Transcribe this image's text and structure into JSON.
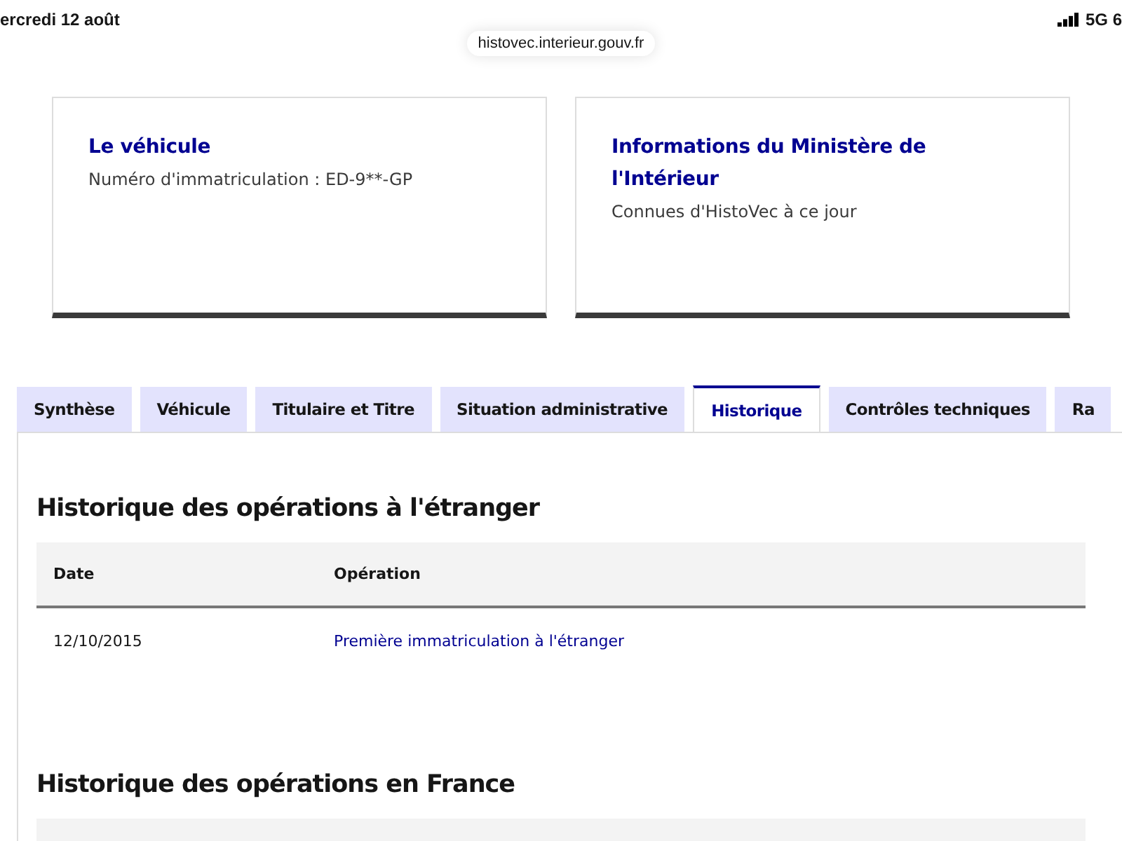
{
  "status_bar": {
    "date": "ercredi 12 août",
    "network": "5G 6"
  },
  "address_bar": {
    "url": "histovec.interieur.gouv.fr"
  },
  "cards": [
    {
      "title": "Le véhicule",
      "text": "Numéro d'immatriculation : ED-9**-GP"
    },
    {
      "title": "Informations du Ministère de l'Intérieur",
      "text": "Connues d'HistoVec à ce jour"
    }
  ],
  "tabs": [
    {
      "label": "Synthèse",
      "selected": false
    },
    {
      "label": "Véhicule",
      "selected": false
    },
    {
      "label": "Titulaire et Titre",
      "selected": false
    },
    {
      "label": "Situation administrative",
      "selected": false
    },
    {
      "label": "Historique",
      "selected": true
    },
    {
      "label": "Contrôles techniques",
      "selected": false
    },
    {
      "label": "Ra",
      "selected": false
    }
  ],
  "sections": [
    {
      "title": "Historique des opérations à l'étranger",
      "table": {
        "columns": [
          "Date",
          "Opération"
        ],
        "rows": [
          [
            "12/10/2015",
            "Première immatriculation à l'étranger"
          ]
        ]
      }
    },
    {
      "title": "Historique des opérations en France"
    }
  ]
}
